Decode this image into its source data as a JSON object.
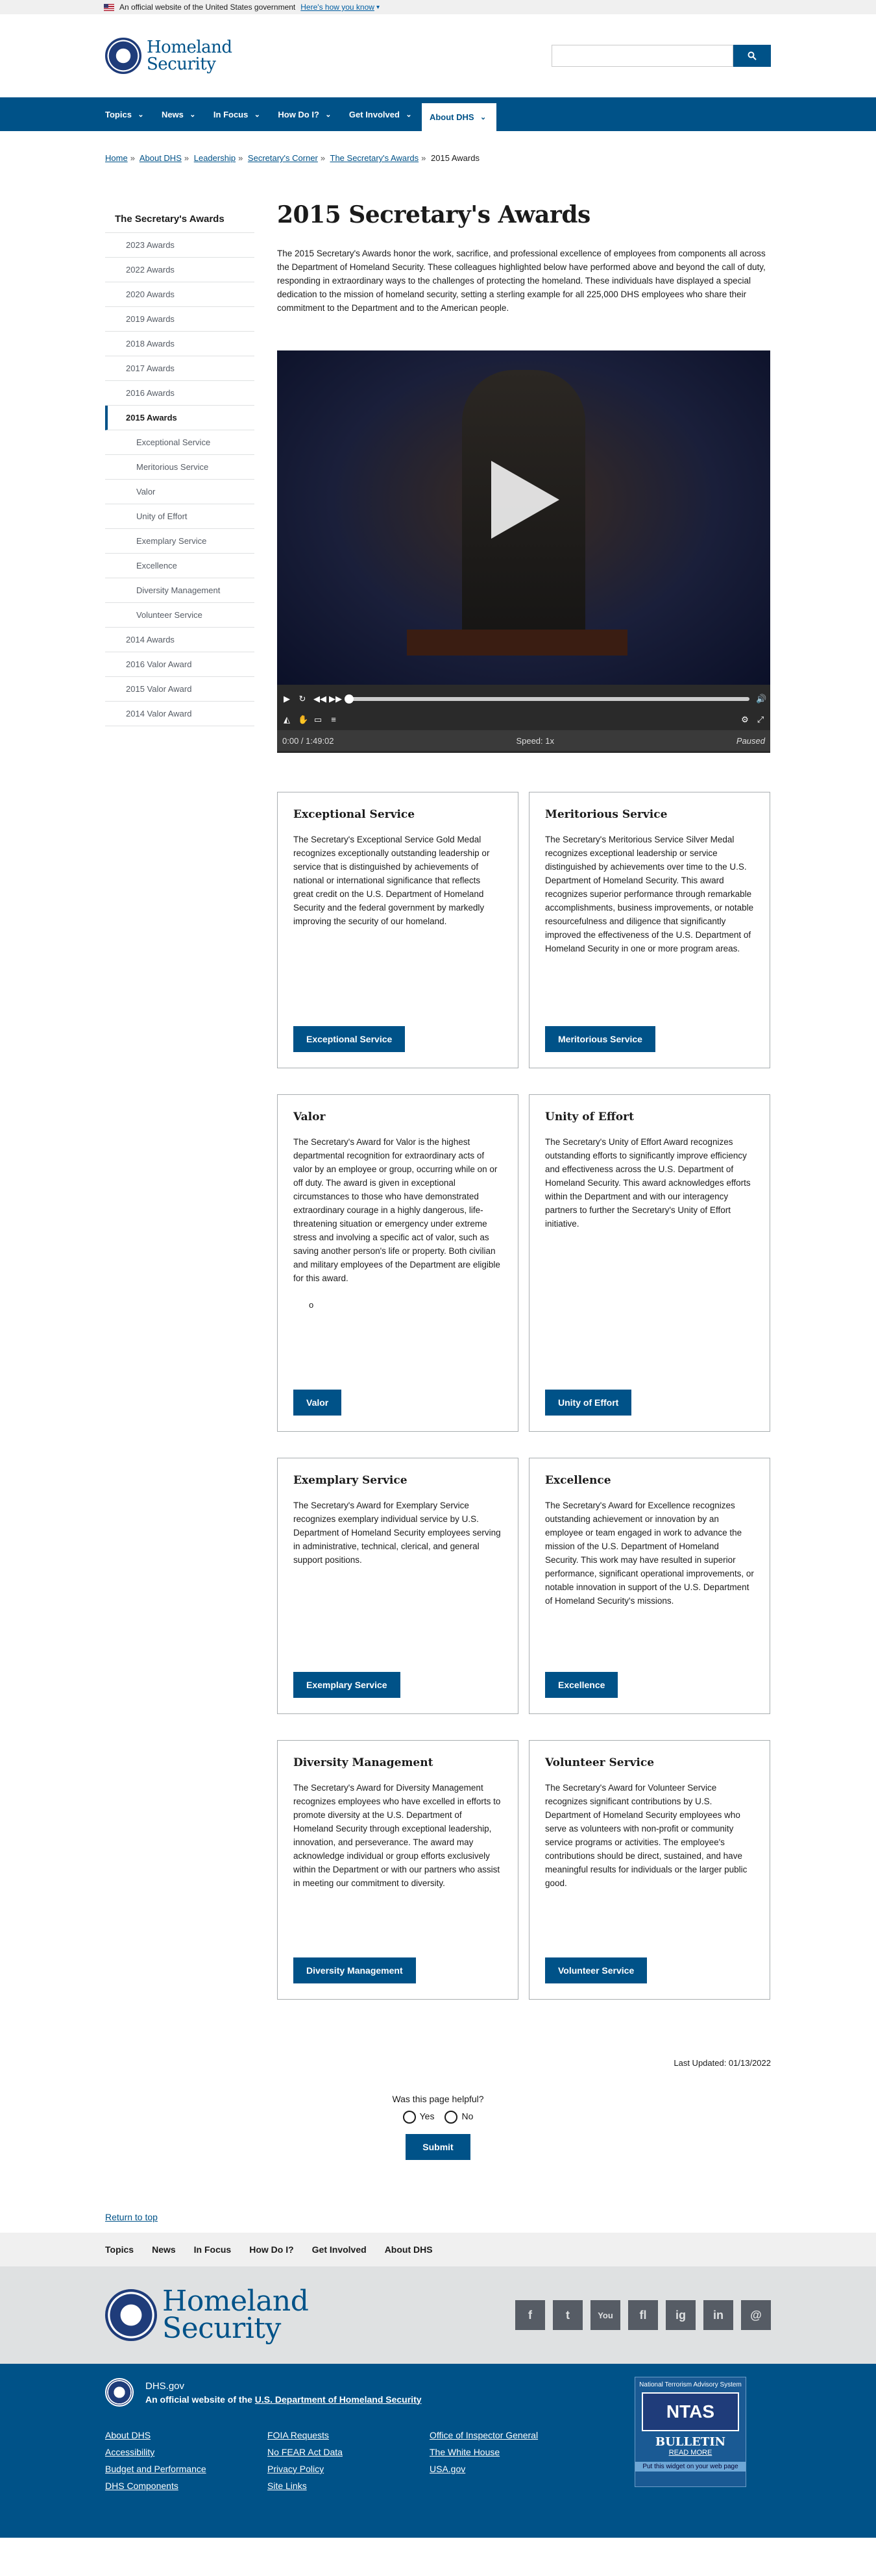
{
  "gov_banner": {
    "text": "An official website of the United States government",
    "link": "Here's how you know"
  },
  "header": {
    "brand_line1": "Homeland",
    "brand_line2": "Security",
    "search_placeholder": ""
  },
  "nav": {
    "items": [
      "Topics",
      "News",
      "In Focus",
      "How Do I?",
      "Get Involved",
      "About DHS"
    ]
  },
  "breadcrumb": {
    "items": [
      "Home",
      "About DHS",
      "Leadership",
      "Secretary's Corner",
      "The Secretary's Awards"
    ],
    "current": "2015 Awards"
  },
  "sidenav": {
    "title": "The Secretary's Awards",
    "items": [
      "2023 Awards",
      "2022 Awards",
      "2020 Awards",
      "2019 Awards",
      "2018 Awards",
      "2017 Awards",
      "2016 Awards"
    ],
    "active": "2015 Awards",
    "sub_items": [
      "Exceptional Service",
      "Meritorious Service",
      "Valor",
      "Unity of Effort",
      "Exemplary Service",
      "Excellence",
      "Diversity Management",
      "Volunteer Service"
    ],
    "after_items": [
      "2014 Awards",
      "2016 Valor Award",
      "2015 Valor Award",
      "2014 Valor Award"
    ]
  },
  "main": {
    "title": "2015 Secretary's Awards",
    "intro": "The 2015 Secretary's Awards honor the work, sacrifice, and professional excellence of employees from components all across the Department of Homeland Security.  These colleagues highlighted below have performed above and beyond the call of duty, responding in extraordinary ways to the challenges of protecting the homeland.  These individuals have displayed a special dedication to the mission of homeland security, setting a sterling example for all 225,000 DHS employees who share their commitment to the Department and to the American people."
  },
  "video": {
    "time": "0:00 / 1:49:02",
    "speed": "Speed: 1x",
    "state": "Paused",
    "progress": 0
  },
  "cards": [
    {
      "title": "Exceptional Service",
      "text": "The Secretary's Exceptional Service Gold Medal recognizes exceptionally outstanding leadership or service that is distinguished by achievements of national or international significance that reflects great credit on the U.S. Department of Homeland Security and the federal government by markedly improving the security of our homeland.",
      "button": "Exceptional Service"
    },
    {
      "title": "Meritorious Service",
      "text": "The Secretary's Meritorious Service Silver Medal recognizes exceptional leadership or service distinguished by achievements over time to the U.S. Department of Homeland Security. This award recognizes superior performance through remarkable accomplishments, business improvements, or notable resourcefulness and diligence that significantly improved the effectiveness of the U.S. Department of Homeland Security in one or more program areas.",
      "button": "Meritorious Service"
    },
    {
      "title": "Valor",
      "text": "The Secretary's Award for Valor is the highest departmental recognition for extraordinary acts of valor by an employee or group, occurring while on or off duty. The award is given in exceptional circumstances to those who have demonstrated extraordinary courage in a highly dangerous, life-threatening situation or emergency under extreme stress and involving a specific act of valor, such as saving another person's life or property. Both civilian and military employees of the Department are eligible for this award.",
      "bullet": "o",
      "button": "Valor"
    },
    {
      "title": "Unity of Effort",
      "text": "The Secretary's Unity of Effort Award recognizes outstanding efforts to significantly improve efficiency and effectiveness across the U.S. Department of Homeland Security. This award acknowledges efforts within the Department and with our interagency partners to further the Secretary's Unity of Effort initiative.",
      "button": "Unity of Effort"
    },
    {
      "title": "Exemplary Service",
      "text": "The Secretary's Award for Exemplary Service recognizes exemplary individual service by U.S. Department of Homeland Security employees serving in administrative, technical, clerical, and general support positions.",
      "button": "Exemplary Service"
    },
    {
      "title": "Excellence",
      "text": "The Secretary's Award for Excellence recognizes outstanding achievement or innovation by an employee or team engaged in work to advance the mission of the U.S. Department of Homeland Security. This work may have resulted in superior performance, significant operational improvements, or notable innovation in support of the U.S. Department of Homeland Security's missions.",
      "button": "Excellence"
    },
    {
      "title": "Diversity Management",
      "text": "The Secretary's Award for Diversity Management recognizes employees who have excelled in efforts to promote diversity at the U.S. Department of Homeland Security through exceptional leadership, innovation, and perseverance. The award may acknowledge individual or group efforts exclusively within the Department or with our partners who assist in meeting our commitment to diversity.",
      "button": "Diversity Management"
    },
    {
      "title": "Volunteer Service",
      "text": "The Secretary's Award for Volunteer Service recognizes significant contributions by U.S. Department of Homeland Security employees who serve as volunteers with non-profit or community service programs or activities. The employee's contributions should be direct, sustained, and have meaningful results for individuals or the larger public good.",
      "button": "Volunteer Service"
    }
  ],
  "last_updated": "Last Updated: 01/13/2022",
  "feedback": {
    "question": "Was this page helpful?",
    "yes": "Yes",
    "no": "No",
    "submit": "Submit"
  },
  "return_top": "Return to top",
  "footer": {
    "nav": [
      "Topics",
      "News",
      "In Focus",
      "How Do I?",
      "Get Involved",
      "About DHS"
    ],
    "brand_line1": "Homeland",
    "brand_line2": "Security",
    "social": [
      "f",
      "t",
      "You",
      "fl",
      "ig",
      "in",
      "@"
    ],
    "site": "DHS.gov",
    "official_prefix": "An official website of the",
    "official_link": "U.S. Department of Homeland Security",
    "links": [
      "About DHS",
      "FOIA Requests",
      "Office of Inspector General",
      "Accessibility",
      "No FEAR Act Data",
      "The White House",
      "Budget and Performance",
      "Privacy Policy",
      "USA.gov",
      "DHS Components",
      "Site Links"
    ],
    "ntas": {
      "header": "National Terrorism Advisory System",
      "logo": "NTAS",
      "bulletin": "BULLETIN",
      "readmore": "READ MORE",
      "subscribe": "Put this widget on your web page"
    }
  },
  "colors": {
    "primary": "#005288",
    "footer_bg": "#005288",
    "light_bg": "#f0f0f0"
  }
}
